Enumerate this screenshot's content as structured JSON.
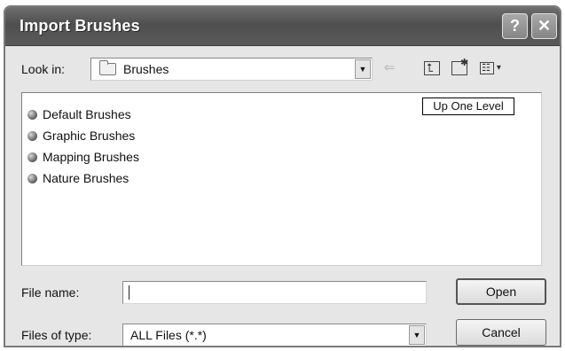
{
  "dialog": {
    "title": "Import Brushes",
    "help_button": "?",
    "close_button": "✕"
  },
  "toolbar": {
    "look_in_label": "Look in:",
    "look_in_value": "Brushes",
    "back_icon": "back-arrow-icon",
    "up_icon": "up-one-level-icon",
    "new_folder_icon": "new-folder-icon",
    "views_icon": "views-menu-icon"
  },
  "tooltip": {
    "text": "Up One Level"
  },
  "file_list": {
    "items": [
      {
        "label": "Default Brushes",
        "icon": "brush-file-icon"
      },
      {
        "label": "Graphic Brushes",
        "icon": "brush-file-icon"
      },
      {
        "label": "Mapping Brushes",
        "icon": "brush-file-icon"
      },
      {
        "label": "Nature Brushes",
        "icon": "brush-file-icon"
      }
    ]
  },
  "form": {
    "file_name_label": "File name:",
    "file_name_value": "",
    "files_of_type_label": "Files of type:",
    "files_of_type_value": "ALL Files (*.*)"
  },
  "buttons": {
    "open_label": "Open",
    "cancel_label": "Cancel"
  }
}
